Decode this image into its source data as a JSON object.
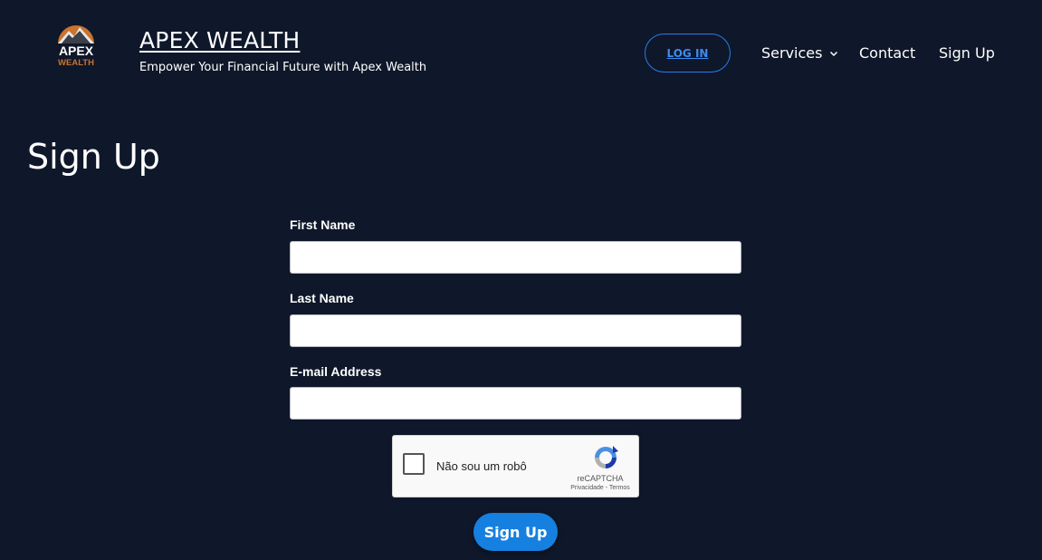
{
  "header": {
    "logo_text_top": "APEX",
    "logo_text_bottom": "WEALTH",
    "brand_title": "APEX WEALTH",
    "tagline": "Empower Your Financial Future with Apex Wealth",
    "login_label": "LOG IN",
    "nav": {
      "services": "Services",
      "contact": "Contact",
      "signup": "Sign Up"
    }
  },
  "main": {
    "title": "Sign Up",
    "form": {
      "first_name_label": "First Name",
      "first_name_value": "",
      "last_name_label": "Last Name",
      "last_name_value": "",
      "email_label": "E-mail Address",
      "email_value": "",
      "submit_label": "Sign Up"
    },
    "recaptcha": {
      "label": "Não sou um robô",
      "brand": "reCAPTCHA",
      "links": "Privacidade - Termos",
      "checked": false
    }
  },
  "colors": {
    "background": "#0f172a",
    "accent": "#1580e0",
    "login_border": "#2b7be8",
    "logo_orange": "#c8732f"
  }
}
